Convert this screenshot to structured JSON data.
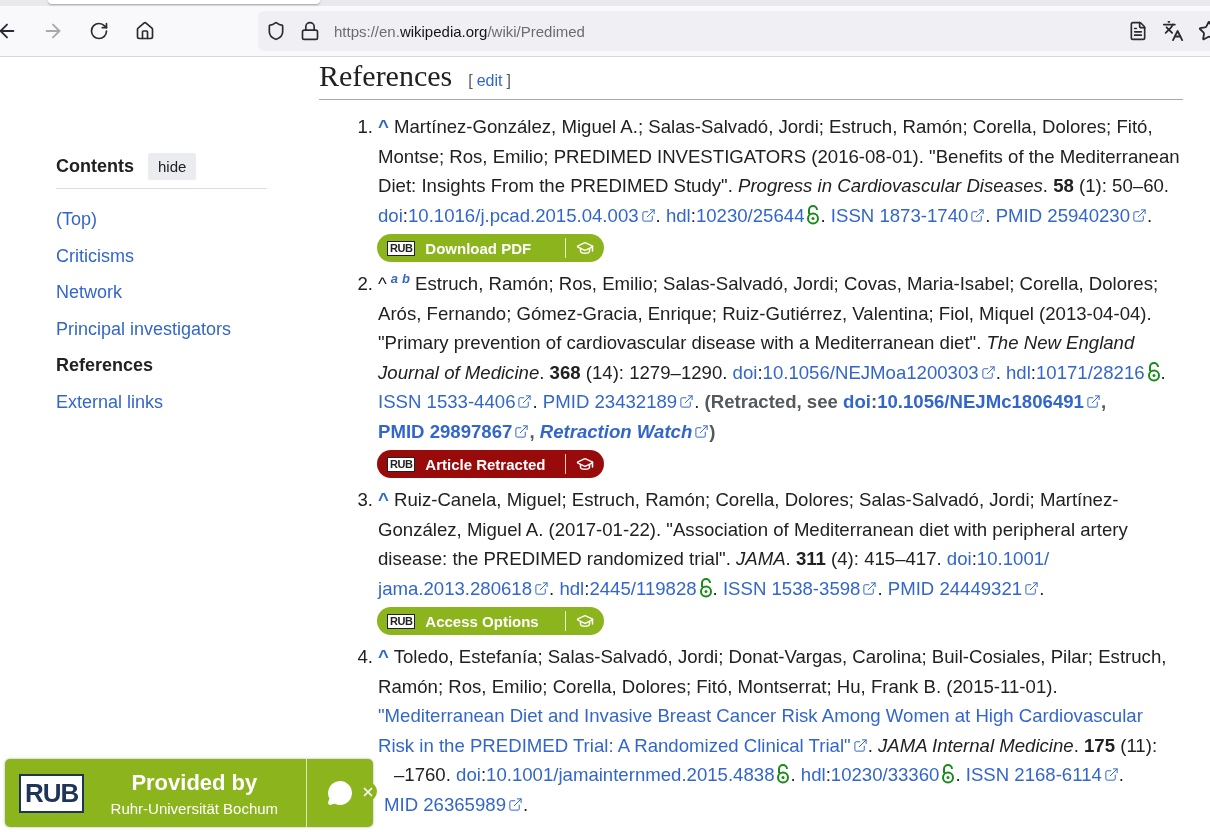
{
  "browser": {
    "url": {
      "prefix": "https://en.",
      "domain": "wikipedia.org",
      "path": "/wiki/Predimed"
    },
    "forward_disabled": true
  },
  "sidebar": {
    "title": "Contents",
    "hide_label": "hide",
    "items": [
      {
        "label": "(Top)",
        "selected": false
      },
      {
        "label": "Criticisms",
        "selected": false
      },
      {
        "label": "Network",
        "selected": false
      },
      {
        "label": "Principal investigators",
        "selected": false
      },
      {
        "label": "References",
        "selected": true
      },
      {
        "label": "External links",
        "selected": false
      }
    ]
  },
  "section": {
    "title": "References",
    "edit_open": "[",
    "edit_label": "edit",
    "edit_close": "]"
  },
  "references": [
    {
      "number": "1.",
      "caret": "^",
      "caret_linked": true,
      "segments": [
        {
          "kind": "text",
          "text": "Martínez-González, Miguel A.; Salas-Salvadó, Jordi; Estruch, Ramón; Corella, Dolores; Fitó, Montse; Ros, Emilio; PREDIMED INVESTIGATORS (2016-08-01). \"Benefits of the Mediterranean Diet: Insights From the PREDIMED Study\". "
        },
        {
          "kind": "italic",
          "text": "Progress in Cardiovascular Diseases"
        },
        {
          "kind": "text",
          "text": ". "
        },
        {
          "kind": "bold",
          "text": "58"
        },
        {
          "kind": "text",
          "text": " (1): 50–60. "
        },
        {
          "kind": "link",
          "text": "doi"
        },
        {
          "kind": "text",
          "text": ":"
        },
        {
          "kind": "extlink",
          "text": "10.1016/j.pcad.2015.04.003"
        },
        {
          "kind": "text",
          "text": ". "
        },
        {
          "kind": "link",
          "text": "hdl"
        },
        {
          "kind": "text",
          "text": ":"
        },
        {
          "kind": "link",
          "text": "10230/25644"
        },
        {
          "kind": "open_access"
        },
        {
          "kind": "text",
          "text": ". "
        },
        {
          "kind": "extlink",
          "text": "ISSN 1873-1740"
        },
        {
          "kind": "text",
          "text": ". "
        },
        {
          "kind": "extlink",
          "text": "PMID 25940230"
        },
        {
          "kind": "text",
          "text": "."
        }
      ],
      "button": {
        "logo": "RUB",
        "label": "Download PDF",
        "color": "#8cb41c"
      }
    },
    {
      "number": "2.",
      "caret": "^",
      "caret_linked": false,
      "letters": [
        "a",
        "b"
      ],
      "segments": [
        {
          "kind": "text",
          "text": "Estruch, Ramón; Ros, Emilio; Salas-Salvadó, Jordi; Covas, Maria-Isabel; Corella, Dolores; Arós, Fernando; Gómez-Gracia, Enrique; Ruiz-Gutiérrez, Valentina; Fiol, Miquel (2013-04-04). \"Primary prevention of cardiovascular disease with a Mediterranean diet\". "
        },
        {
          "kind": "italic",
          "text": "The New England Journal of Medicine"
        },
        {
          "kind": "text",
          "text": ". "
        },
        {
          "kind": "bold",
          "text": "368"
        },
        {
          "kind": "text",
          "text": " (14): 1279–1290. "
        },
        {
          "kind": "link",
          "text": "doi"
        },
        {
          "kind": "text",
          "text": ":"
        },
        {
          "kind": "extlink",
          "text": "10.1056/NEJMoa1200303"
        },
        {
          "kind": "text",
          "text": ". "
        },
        {
          "kind": "link",
          "text": "hdl"
        },
        {
          "kind": "text",
          "text": ":"
        },
        {
          "kind": "link",
          "text": "10171/28216"
        },
        {
          "kind": "open_access"
        },
        {
          "kind": "text",
          "text": ". "
        },
        {
          "kind": "extlink",
          "text": "ISSN 1533-4406"
        },
        {
          "kind": "text",
          "text": ". "
        },
        {
          "kind": "extlink",
          "text": "PMID 23432189"
        },
        {
          "kind": "text",
          "text": ". "
        },
        {
          "kind": "strong",
          "text": "(Retracted, see "
        },
        {
          "kind": "strong_link",
          "text": "doi"
        },
        {
          "kind": "strong",
          "text": ":"
        },
        {
          "kind": "strong_extlink",
          "text": "10.1056/NEJMc1806491"
        },
        {
          "kind": "strong",
          "text": ", "
        },
        {
          "kind": "strong_extlink",
          "text": "PMID 29897867"
        },
        {
          "kind": "strong",
          "text": ",  "
        },
        {
          "kind": "strong_italic_extlink",
          "text": "Retraction Watch"
        },
        {
          "kind": "strong",
          "text": ")"
        }
      ],
      "button": {
        "logo": "RUB",
        "label": "Article Retracted",
        "color": "#990a0a"
      }
    },
    {
      "number": "3.",
      "caret": "^",
      "caret_linked": true,
      "segments": [
        {
          "kind": "text",
          "text": "Ruiz-Canela, Miguel; Estruch, Ramón; Corella, Dolores; Salas-Salvadó, Jordi; Martínez-González, Miguel A. (2017-01-22). \"Association of Mediterranean diet with peripheral artery disease: the PREDIMED randomized trial\". "
        },
        {
          "kind": "italic",
          "text": "JAMA"
        },
        {
          "kind": "text",
          "text": ". "
        },
        {
          "kind": "bold",
          "text": "311"
        },
        {
          "kind": "text",
          "text": " (4): 415–417. "
        },
        {
          "kind": "link",
          "text": "doi"
        },
        {
          "kind": "text",
          "text": ":"
        },
        {
          "kind": "link",
          "text": "10.1001/"
        },
        {
          "kind": "extlink",
          "text": "jama.2013.280618"
        },
        {
          "kind": "text",
          "text": ". "
        },
        {
          "kind": "link",
          "text": "hdl"
        },
        {
          "kind": "text",
          "text": ":"
        },
        {
          "kind": "link",
          "text": "2445/119828"
        },
        {
          "kind": "open_access"
        },
        {
          "kind": "text",
          "text": ". "
        },
        {
          "kind": "extlink",
          "text": "ISSN 1538-3598"
        },
        {
          "kind": "text",
          "text": ". "
        },
        {
          "kind": "extlink",
          "text": "PMID 24449321"
        },
        {
          "kind": "text",
          "text": "."
        }
      ],
      "button": {
        "logo": "RUB",
        "label": "Access Options",
        "color": "#8cb41c"
      }
    },
    {
      "number": "4.",
      "caret": "^",
      "caret_linked": true,
      "segments": [
        {
          "kind": "text",
          "text": "Toledo, Estefanía; Salas-Salvadó, Jordi; Donat-Vargas, Carolina; Buil-Cosiales, Pilar; Estruch, Ramón; Ros, Emilio; Corella, Dolores; Fitó, Montserrat; Hu, Frank B. (2015-11-01). "
        },
        {
          "kind": "link",
          "text": "\"Mediterranean Diet and Invasive Breast Cancer Risk Among Women at High Cardiovascular"
        },
        {
          "kind": "extlink",
          "text": "Risk in the PREDIMED Trial: A Randomized Clinical Trial\""
        },
        {
          "kind": "text",
          "text": ". "
        },
        {
          "kind": "italic",
          "text": "JAMA Internal Medicine"
        },
        {
          "kind": "text",
          "text": ". "
        },
        {
          "kind": "bold",
          "text": "175"
        },
        {
          "kind": "text",
          "text": " (11): "
        },
        {
          "kind": "covered",
          "text": "–1760. "
        },
        {
          "kind": "link",
          "text": "doi"
        },
        {
          "kind": "text",
          "text": ":"
        },
        {
          "kind": "link",
          "text": "10.1001/jamainternmed.2015.4838"
        },
        {
          "kind": "open_access"
        },
        {
          "kind": "text",
          "text": ". "
        },
        {
          "kind": "link",
          "text": "hdl"
        },
        {
          "kind": "text",
          "text": ":"
        },
        {
          "kind": "link",
          "text": "10230/33360"
        },
        {
          "kind": "open_access"
        },
        {
          "kind": "text",
          "text": ". "
        },
        {
          "kind": "extlink",
          "text": "ISSN 2168-6114"
        },
        {
          "kind": "text",
          "text": ". "
        },
        {
          "kind": "covered_extlink",
          "text": "MID 26365989"
        },
        {
          "kind": "text",
          "text": "."
        }
      ]
    }
  ],
  "provider": {
    "logo": "RUB",
    "title": "Provided by",
    "subtitle": "Ruhr-Universität Bochum"
  }
}
